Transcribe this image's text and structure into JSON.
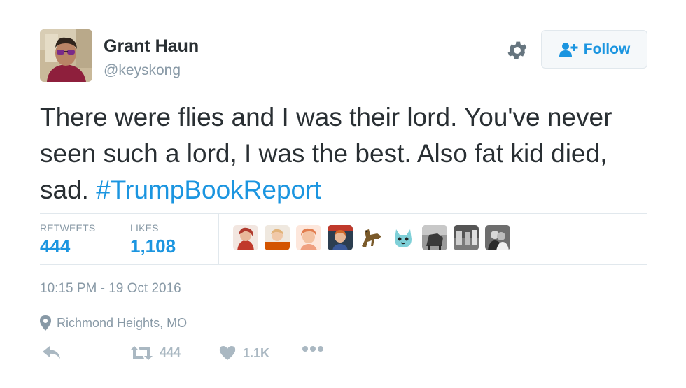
{
  "author": {
    "name": "Grant Haun",
    "handle": "@keyskong"
  },
  "header": {
    "follow_label": "Follow"
  },
  "tweet": {
    "text": "There were flies and I was their lord. You've never seen such a lord, I was the best. Also fat kid died, sad. ",
    "hashtag": "#TrumpBookReport"
  },
  "stats": {
    "retweets_label": "RETWEETS",
    "retweets_value": "444",
    "likes_label": "LIKES",
    "likes_value": "1,108"
  },
  "likers": [
    {
      "color": "#c0392b"
    },
    {
      "color": "#d35400"
    },
    {
      "color": "#e8a890"
    },
    {
      "color": "#2c3e50"
    },
    {
      "color": "#7a5a2a"
    },
    {
      "color": "#7fd0d8"
    },
    {
      "color": "#3a3a3a"
    },
    {
      "color": "#555555"
    },
    {
      "color": "#6e6e6e"
    }
  ],
  "meta": {
    "timestamp": "10:15 PM - 19 Oct 2016",
    "location": "Richmond Heights, MO"
  },
  "actions": {
    "retweet_count": "444",
    "like_count": "1.1K"
  },
  "colors": {
    "link": "#1b95e0",
    "muted": "#8899a6",
    "text": "#292f33"
  }
}
